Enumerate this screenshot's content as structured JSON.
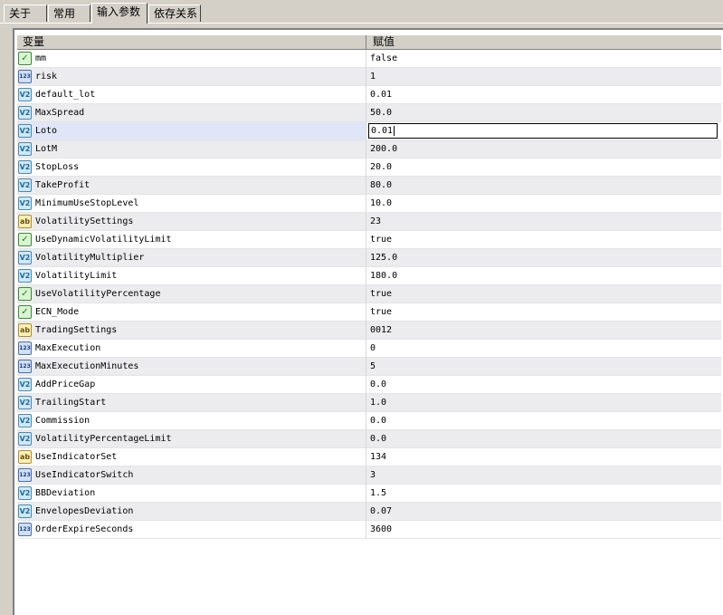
{
  "tabs": [
    {
      "label": "关于",
      "active": false
    },
    {
      "label": "常用",
      "active": false
    },
    {
      "label": "输入参数",
      "active": true
    },
    {
      "label": "依存关系",
      "active": false
    }
  ],
  "table": {
    "columns": [
      "变量",
      "赋值"
    ],
    "selected_index": 4,
    "rows": [
      {
        "icon": "bool-icon",
        "type": "bool",
        "name": "mm",
        "value": "false"
      },
      {
        "icon": "int-icon",
        "type": "int",
        "name": "risk",
        "value": "1"
      },
      {
        "icon": "double-icon",
        "type": "double",
        "name": "default_lot",
        "value": "0.01"
      },
      {
        "icon": "double-icon",
        "type": "double",
        "name": "MaxSpread",
        "value": "50.0"
      },
      {
        "icon": "double-icon",
        "type": "double",
        "name": "Loto",
        "value": "0.01"
      },
      {
        "icon": "double-icon",
        "type": "double",
        "name": "LotM",
        "value": "200.0"
      },
      {
        "icon": "double-icon",
        "type": "double",
        "name": "StopLoss",
        "value": "20.0"
      },
      {
        "icon": "double-icon",
        "type": "double",
        "name": "TakeProfit",
        "value": "80.0"
      },
      {
        "icon": "double-icon",
        "type": "double",
        "name": "MinimumUseStopLevel",
        "value": "10.0"
      },
      {
        "icon": "string-icon",
        "type": "string",
        "name": "VolatilitySettings",
        "value": "23"
      },
      {
        "icon": "bool-icon",
        "type": "bool",
        "name": "UseDynamicVolatilityLimit",
        "value": "true"
      },
      {
        "icon": "double-icon",
        "type": "double",
        "name": "VolatilityMultiplier",
        "value": "125.0"
      },
      {
        "icon": "double-icon",
        "type": "double",
        "name": "VolatilityLimit",
        "value": "180.0"
      },
      {
        "icon": "bool-icon",
        "type": "bool",
        "name": "UseVolatilityPercentage",
        "value": "true"
      },
      {
        "icon": "bool-icon",
        "type": "bool",
        "name": "ECN_Mode",
        "value": "true"
      },
      {
        "icon": "string-icon",
        "type": "string",
        "name": "TradingSettings",
        "value": "0012"
      },
      {
        "icon": "int-icon",
        "type": "int",
        "name": "MaxExecution",
        "value": "0"
      },
      {
        "icon": "int-icon",
        "type": "int",
        "name": "MaxExecutionMinutes",
        "value": "5"
      },
      {
        "icon": "double-icon",
        "type": "double",
        "name": "AddPriceGap",
        "value": "0.0"
      },
      {
        "icon": "double-icon",
        "type": "double",
        "name": "TrailingStart",
        "value": "1.0"
      },
      {
        "icon": "double-icon",
        "type": "double",
        "name": "Commission",
        "value": "0.0"
      },
      {
        "icon": "double-icon",
        "type": "double",
        "name": "VolatilityPercentageLimit",
        "value": "0.0"
      },
      {
        "icon": "string-icon",
        "type": "string",
        "name": "UseIndicatorSet",
        "value": "134"
      },
      {
        "icon": "int-icon",
        "type": "int",
        "name": "UseIndicatorSwitch",
        "value": "3"
      },
      {
        "icon": "double-icon",
        "type": "double",
        "name": "BBDeviation",
        "value": "1.5"
      },
      {
        "icon": "double-icon",
        "type": "double",
        "name": "EnvelopesDeviation",
        "value": "0.07"
      },
      {
        "icon": "int-icon",
        "type": "int",
        "name": "OrderExpireSeconds",
        "value": "3600"
      }
    ]
  },
  "icon_glyphs": {
    "bool": "✓",
    "int": "123",
    "double": "V2",
    "string": "ab"
  },
  "colors": {
    "selected_row": "#e0e6f8",
    "alt_row": "#ecebee",
    "window": "#d4d0c8"
  }
}
